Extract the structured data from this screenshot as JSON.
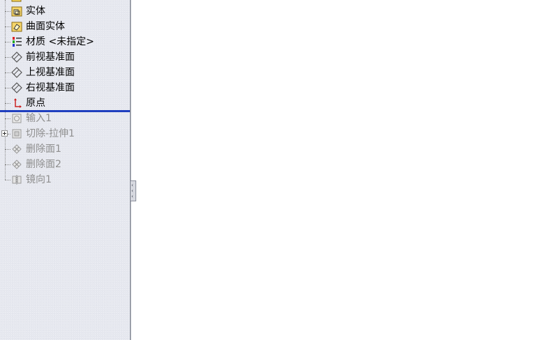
{
  "feature_tree": {
    "items": [
      {
        "label": "实体",
        "icon": "solid-bodies-folder-icon"
      },
      {
        "label": "曲面实体",
        "icon": "surface-bodies-folder-icon"
      },
      {
        "label": "材质 <未指定>",
        "icon": "material-icon"
      },
      {
        "label": "前视基准面",
        "icon": "plane-icon"
      },
      {
        "label": "上视基准面",
        "icon": "plane-icon"
      },
      {
        "label": "右视基准面",
        "icon": "plane-icon"
      },
      {
        "label": "原点",
        "icon": "origin-icon"
      },
      {
        "label": "输入1",
        "icon": "imported-feature-icon",
        "suppressed": true
      },
      {
        "label": "切除-拉伸1",
        "icon": "cut-extrude-icon",
        "suppressed": true
      },
      {
        "label": "删除面1",
        "icon": "delete-face-icon",
        "suppressed": true
      },
      {
        "label": "删除面2",
        "icon": "delete-face-icon",
        "suppressed": true
      },
      {
        "label": "镜向1",
        "icon": "mirror-icon",
        "suppressed": true
      }
    ]
  },
  "colors": {
    "panel_bg": "#e6e8ef",
    "rollback_bar": "#1f3fbf",
    "suppressed_text": "#8f8f8f"
  }
}
